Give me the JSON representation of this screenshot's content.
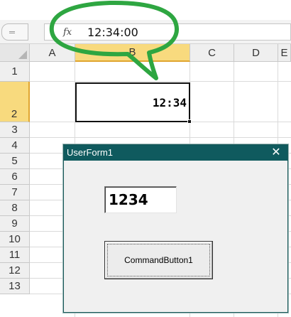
{
  "formula_bar": {
    "fx_label": "fx",
    "formula_value": "12:34:00"
  },
  "columns": [
    "A",
    "B",
    "C",
    "D",
    "E"
  ],
  "selected_column": "B",
  "rows": [
    "1",
    "2",
    "3",
    "4",
    "5",
    "6",
    "7",
    "8",
    "9",
    "10",
    "11",
    "12",
    "13"
  ],
  "selected_row": "2",
  "active_cell": {
    "address": "B2",
    "display_value": "12:34"
  },
  "userform": {
    "title": "UserForm1",
    "close_glyph": "✕",
    "textbox_value": "1234",
    "button_label": "CommandButton1"
  },
  "colors": {
    "callout_outline": "#2ea641",
    "userform_titlebar": "#0f5a5e",
    "selected_header": "#f8da7e"
  }
}
